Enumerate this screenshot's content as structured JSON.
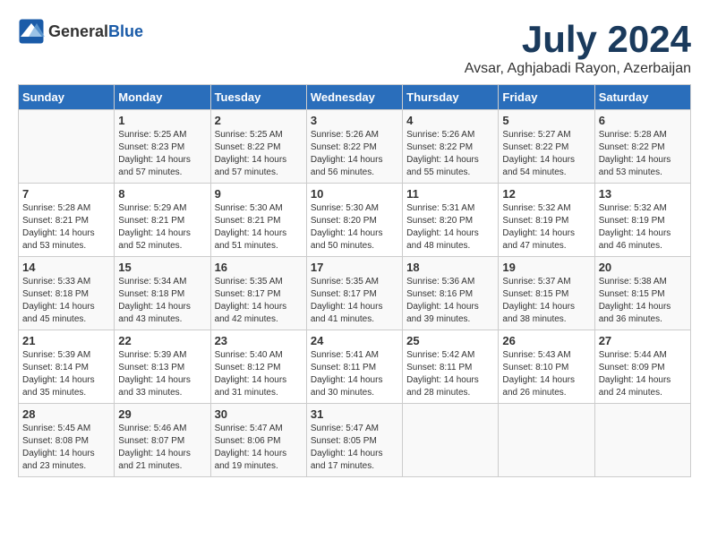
{
  "header": {
    "logo_general": "General",
    "logo_blue": "Blue",
    "month": "July 2024",
    "location": "Avsar, Aghjabadi Rayon, Azerbaijan"
  },
  "days_of_week": [
    "Sunday",
    "Monday",
    "Tuesday",
    "Wednesday",
    "Thursday",
    "Friday",
    "Saturday"
  ],
  "weeks": [
    [
      {
        "day": "",
        "info": ""
      },
      {
        "day": "1",
        "info": "Sunrise: 5:25 AM\nSunset: 8:23 PM\nDaylight: 14 hours\nand 57 minutes."
      },
      {
        "day": "2",
        "info": "Sunrise: 5:25 AM\nSunset: 8:22 PM\nDaylight: 14 hours\nand 57 minutes."
      },
      {
        "day": "3",
        "info": "Sunrise: 5:26 AM\nSunset: 8:22 PM\nDaylight: 14 hours\nand 56 minutes."
      },
      {
        "day": "4",
        "info": "Sunrise: 5:26 AM\nSunset: 8:22 PM\nDaylight: 14 hours\nand 55 minutes."
      },
      {
        "day": "5",
        "info": "Sunrise: 5:27 AM\nSunset: 8:22 PM\nDaylight: 14 hours\nand 54 minutes."
      },
      {
        "day": "6",
        "info": "Sunrise: 5:28 AM\nSunset: 8:22 PM\nDaylight: 14 hours\nand 53 minutes."
      }
    ],
    [
      {
        "day": "7",
        "info": "Sunrise: 5:28 AM\nSunset: 8:21 PM\nDaylight: 14 hours\nand 53 minutes."
      },
      {
        "day": "8",
        "info": "Sunrise: 5:29 AM\nSunset: 8:21 PM\nDaylight: 14 hours\nand 52 minutes."
      },
      {
        "day": "9",
        "info": "Sunrise: 5:30 AM\nSunset: 8:21 PM\nDaylight: 14 hours\nand 51 minutes."
      },
      {
        "day": "10",
        "info": "Sunrise: 5:30 AM\nSunset: 8:20 PM\nDaylight: 14 hours\nand 50 minutes."
      },
      {
        "day": "11",
        "info": "Sunrise: 5:31 AM\nSunset: 8:20 PM\nDaylight: 14 hours\nand 48 minutes."
      },
      {
        "day": "12",
        "info": "Sunrise: 5:32 AM\nSunset: 8:19 PM\nDaylight: 14 hours\nand 47 minutes."
      },
      {
        "day": "13",
        "info": "Sunrise: 5:32 AM\nSunset: 8:19 PM\nDaylight: 14 hours\nand 46 minutes."
      }
    ],
    [
      {
        "day": "14",
        "info": "Sunrise: 5:33 AM\nSunset: 8:18 PM\nDaylight: 14 hours\nand 45 minutes."
      },
      {
        "day": "15",
        "info": "Sunrise: 5:34 AM\nSunset: 8:18 PM\nDaylight: 14 hours\nand 43 minutes."
      },
      {
        "day": "16",
        "info": "Sunrise: 5:35 AM\nSunset: 8:17 PM\nDaylight: 14 hours\nand 42 minutes."
      },
      {
        "day": "17",
        "info": "Sunrise: 5:35 AM\nSunset: 8:17 PM\nDaylight: 14 hours\nand 41 minutes."
      },
      {
        "day": "18",
        "info": "Sunrise: 5:36 AM\nSunset: 8:16 PM\nDaylight: 14 hours\nand 39 minutes."
      },
      {
        "day": "19",
        "info": "Sunrise: 5:37 AM\nSunset: 8:15 PM\nDaylight: 14 hours\nand 38 minutes."
      },
      {
        "day": "20",
        "info": "Sunrise: 5:38 AM\nSunset: 8:15 PM\nDaylight: 14 hours\nand 36 minutes."
      }
    ],
    [
      {
        "day": "21",
        "info": "Sunrise: 5:39 AM\nSunset: 8:14 PM\nDaylight: 14 hours\nand 35 minutes."
      },
      {
        "day": "22",
        "info": "Sunrise: 5:39 AM\nSunset: 8:13 PM\nDaylight: 14 hours\nand 33 minutes."
      },
      {
        "day": "23",
        "info": "Sunrise: 5:40 AM\nSunset: 8:12 PM\nDaylight: 14 hours\nand 31 minutes."
      },
      {
        "day": "24",
        "info": "Sunrise: 5:41 AM\nSunset: 8:11 PM\nDaylight: 14 hours\nand 30 minutes."
      },
      {
        "day": "25",
        "info": "Sunrise: 5:42 AM\nSunset: 8:11 PM\nDaylight: 14 hours\nand 28 minutes."
      },
      {
        "day": "26",
        "info": "Sunrise: 5:43 AM\nSunset: 8:10 PM\nDaylight: 14 hours\nand 26 minutes."
      },
      {
        "day": "27",
        "info": "Sunrise: 5:44 AM\nSunset: 8:09 PM\nDaylight: 14 hours\nand 24 minutes."
      }
    ],
    [
      {
        "day": "28",
        "info": "Sunrise: 5:45 AM\nSunset: 8:08 PM\nDaylight: 14 hours\nand 23 minutes."
      },
      {
        "day": "29",
        "info": "Sunrise: 5:46 AM\nSunset: 8:07 PM\nDaylight: 14 hours\nand 21 minutes."
      },
      {
        "day": "30",
        "info": "Sunrise: 5:47 AM\nSunset: 8:06 PM\nDaylight: 14 hours\nand 19 minutes."
      },
      {
        "day": "31",
        "info": "Sunrise: 5:47 AM\nSunset: 8:05 PM\nDaylight: 14 hours\nand 17 minutes."
      },
      {
        "day": "",
        "info": ""
      },
      {
        "day": "",
        "info": ""
      },
      {
        "day": "",
        "info": ""
      }
    ]
  ]
}
